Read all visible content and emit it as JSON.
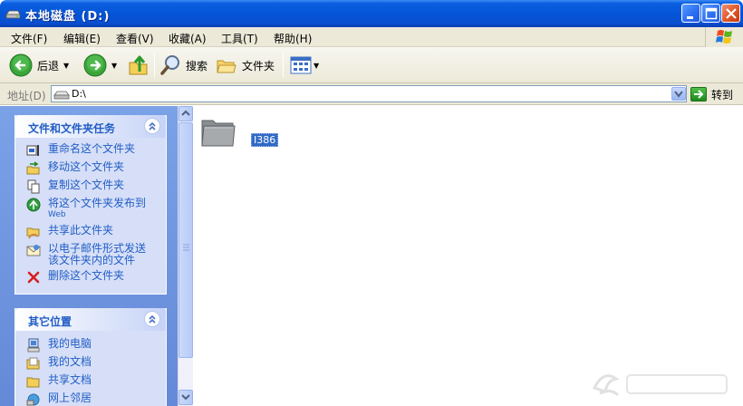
{
  "window": {
    "title": "本地磁盘  (D:)"
  },
  "menu": {
    "items": [
      "文件(F)",
      "编辑(E)",
      "查看(V)",
      "收藏(A)",
      "工具(T)",
      "帮助(H)"
    ]
  },
  "toolbar": {
    "back_label": "后退",
    "search_label": "搜索",
    "folders_label": "文件夹"
  },
  "address": {
    "label": "地址(D)",
    "value": "D:\\",
    "go_label": "转到"
  },
  "left_panel": {
    "tasks": {
      "header": "文件和文件夹任务",
      "items": [
        {
          "label": "重命名这个文件夹",
          "icon": "rename-icon"
        },
        {
          "label": "移动这个文件夹",
          "icon": "move-icon"
        },
        {
          "label": "复制这个文件夹",
          "icon": "copy-icon"
        },
        {
          "label": "将这个文件夹发布到",
          "sub": "Web",
          "icon": "publish-web-icon"
        },
        {
          "label": "共享此文件夹",
          "icon": "share-icon"
        },
        {
          "label": "以电子邮件形式发送",
          "sub": "该文件夹内的文件",
          "icon": "email-icon"
        },
        {
          "label": "删除这个文件夹",
          "icon": "delete-icon"
        }
      ]
    },
    "other_places": {
      "header": "其它位置",
      "items": [
        {
          "label": "我的电脑",
          "icon": "my-computer-icon"
        },
        {
          "label": "我的文档",
          "icon": "my-documents-icon"
        },
        {
          "label": "共享文档",
          "icon": "shared-documents-icon"
        },
        {
          "label": "网上邻居",
          "icon": "network-icon"
        }
      ]
    }
  },
  "main": {
    "files": [
      {
        "name": "I386",
        "type": "folder",
        "selected": true
      }
    ]
  },
  "colors": {
    "titlebar": "#0553d6",
    "task_link": "#215dc6",
    "selection": "#316ac5",
    "panel_bg": "#7ba2e7"
  }
}
